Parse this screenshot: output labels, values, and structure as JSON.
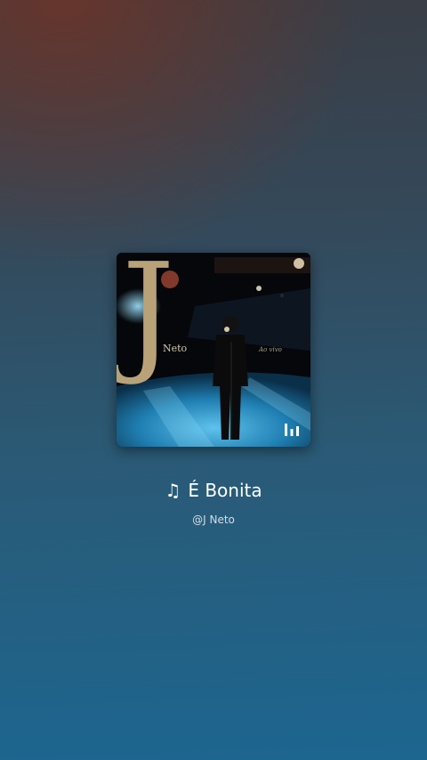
{
  "album": {
    "cover_letter": "J",
    "cover_artist_text": "Neto",
    "cover_subtitle": "Ao vivo",
    "playing_indicator_icon": "equalizer-bars-icon"
  },
  "track": {
    "note_icon": "♫",
    "title": "É Bonita",
    "artist": "@J Neto"
  }
}
